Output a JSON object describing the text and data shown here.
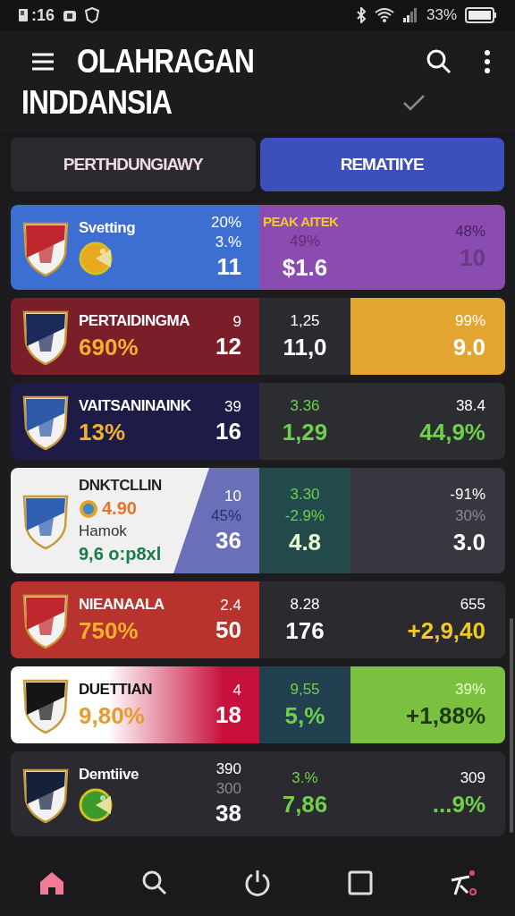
{
  "status_bar": {
    "time": ":16",
    "battery": "33%"
  },
  "header": {
    "title_lines": [
      "OLAHRAGAN",
      "INDDANSIA"
    ]
  },
  "tabs": [
    {
      "label": "PERTHDUNGIAWY",
      "selected": false
    },
    {
      "label": "REMATIIYE",
      "selected": true
    }
  ],
  "cards": [
    {
      "left": {
        "color": "#3d6fd2"
      },
      "name": {
        "text": "Svetting",
        "color": "#ffffff"
      },
      "lines": [
        {
          "kind": "icon",
          "color": "#e8a820"
        }
      ],
      "stats": [
        {
          "text": "20%",
          "kind": "small",
          "color": "#ffffff"
        },
        {
          "text": "3.%",
          "kind": "small",
          "color": "#ffffff"
        },
        {
          "text": "11",
          "kind": "big",
          "color": "#ffffff"
        }
      ],
      "mid": {
        "color": "#8a4cb0",
        "lines": [
          {
            "text": "PEAK AITEK",
            "kind": "label",
            "color": "#f2c82c"
          },
          {
            "text": "49%",
            "kind": "small",
            "color": "#6a2a70"
          },
          {
            "text": "$1.6",
            "kind": "big",
            "color": "#ffffff"
          }
        ]
      },
      "right": {
        "color": "#8a4cb0",
        "lines": [
          {
            "text": "48%",
            "kind": "small",
            "color": "#4a2260"
          },
          {
            "text": "10",
            "kind": "big",
            "color": "#6a3a80"
          }
        ]
      }
    },
    {
      "left": {
        "color": "#7a1f2a"
      },
      "name": {
        "text": "PERTAIDINGMA",
        "color": "#ffffff"
      },
      "lines": [
        {
          "kind": "big",
          "text": "690%",
          "color": "#f2b12c"
        }
      ],
      "stats": [
        {
          "text": "9",
          "kind": "small",
          "color": "#ffffff"
        },
        {
          "text": "12",
          "kind": "big",
          "color": "#ffffff"
        }
      ],
      "mid": {
        "color": "#2b2b2f",
        "lines": [
          {
            "text": "1,25",
            "kind": "small",
            "color": "#ffffff"
          },
          {
            "text": "11,0",
            "kind": "big",
            "color": "#ffffff"
          }
        ]
      },
      "right": {
        "color": "#e3a532",
        "lines": [
          {
            "text": "99%",
            "kind": "small",
            "color": "#ffffff"
          },
          {
            "text": "9.0",
            "kind": "big",
            "color": "#ffffff"
          }
        ]
      }
    },
    {
      "left": {
        "color": "#1e1b46"
      },
      "name": {
        "text": "VAITSANINAINK",
        "color": "#ffffff"
      },
      "lines": [
        {
          "kind": "big",
          "text": "13%",
          "color": "#f2b12c"
        }
      ],
      "stats": [
        {
          "text": "39",
          "kind": "small",
          "color": "#ffffff"
        },
        {
          "text": "16",
          "kind": "big",
          "color": "#ffffff"
        }
      ],
      "mid": {
        "color": "#2c2d30",
        "lines": [
          {
            "text": "3.36",
            "kind": "small",
            "color": "#6fd04a"
          },
          {
            "text": "1,29",
            "kind": "big",
            "color": "#6fd04a"
          }
        ]
      },
      "right": {
        "color": "#2c2d30",
        "lines": [
          {
            "text": "38.4",
            "kind": "small",
            "color": "#ffffff"
          },
          {
            "text": "44,9%",
            "kind": "big",
            "color": "#6fd04a"
          }
        ]
      }
    },
    {
      "left": {
        "color": "#f0f0f0",
        "band": {
          "kind": "split",
          "color": "#6a70b8"
        }
      },
      "name": {
        "text": "DNKTCLLIN",
        "color": "#222222"
      },
      "lines": [
        {
          "kind": "icon-text",
          "text": "4.90",
          "color": "#e8742a"
        },
        {
          "kind": "small",
          "text": "Hamok",
          "color": "#333333"
        },
        {
          "kind": "mid",
          "text": "9,6 o:p8xl",
          "color": "#1a7a4a"
        }
      ],
      "stats": [
        {
          "text": "10",
          "kind": "small",
          "color": "#ffffff"
        },
        {
          "text": "45%",
          "kind": "small",
          "color": "#2a2e70"
        },
        {
          "text": "36",
          "kind": "big",
          "color": "#ffffff"
        }
      ],
      "mid": {
        "color": "#234a4a",
        "lines": [
          {
            "text": "3.30",
            "kind": "small",
            "color": "#6fd04a"
          },
          {
            "text": "-2.9%",
            "kind": "small",
            "color": "#6fd04a"
          },
          {
            "text": "4.8",
            "kind": "big",
            "color": "#e8ffd0"
          }
        ]
      },
      "right": {
        "color": "#38363f",
        "lines": [
          {
            "text": "-91%",
            "kind": "small",
            "color": "#ffffff"
          },
          {
            "text": "30%",
            "kind": "small",
            "color": "#8c8a9c"
          },
          {
            "text": "3.0",
            "kind": "big",
            "color": "#ffffff"
          }
        ]
      }
    },
    {
      "left": {
        "color": "#b8322e"
      },
      "name": {
        "text": "NIEANAALA",
        "color": "#ffffff"
      },
      "lines": [
        {
          "kind": "big",
          "text": "750%",
          "color": "#f2b12c"
        }
      ],
      "stats": [
        {
          "text": "2.4",
          "kind": "small",
          "color": "#ffffff"
        },
        {
          "text": "50",
          "kind": "big",
          "color": "#ffffff"
        }
      ],
      "mid": {
        "color": "#2b2b2f",
        "lines": [
          {
            "text": "8.28",
            "kind": "small",
            "color": "#ffffff"
          },
          {
            "text": "176",
            "kind": "big",
            "color": "#ffffff"
          }
        ]
      },
      "right": {
        "color": "#2b2b2f",
        "lines": [
          {
            "text": "655",
            "kind": "small",
            "color": "#ffffff"
          },
          {
            "text": "+2,9,40",
            "kind": "big",
            "color": "#f0c828"
          }
        ]
      }
    },
    {
      "left": {
        "color": "#ffffff",
        "band": {
          "kind": "fade",
          "color": "#c8103c"
        }
      },
      "name": {
        "text": "DUETTIAN",
        "color": "#111111"
      },
      "lines": [
        {
          "kind": "big",
          "text": "9,80%",
          "color": "#e89a2a"
        }
      ],
      "stats": [
        {
          "text": "4",
          "kind": "small",
          "color": "#ffffff"
        },
        {
          "text": "18",
          "kind": "big",
          "color": "#ffffff"
        }
      ],
      "mid": {
        "color": "#234050",
        "lines": [
          {
            "text": "9,55",
            "kind": "small",
            "color": "#6fd04a"
          },
          {
            "text": "5,%",
            "kind": "big",
            "color": "#6fd04a"
          }
        ]
      },
      "right": {
        "color": "#7cc040",
        "lines": [
          {
            "text": "39%",
            "kind": "small",
            "color": "#e8ffd0"
          },
          {
            "text": "+1,88%",
            "kind": "big",
            "color": "#1e3a14"
          }
        ]
      }
    },
    {
      "left": {
        "color": "#2a2a30"
      },
      "name": {
        "text": "Demtiive",
        "color": "#ffffff"
      },
      "lines": [
        {
          "kind": "icon",
          "color": "#3a9a2a"
        }
      ],
      "stats": [
        {
          "text": "390",
          "kind": "small",
          "color": "#ffffff"
        },
        {
          "text": "300",
          "kind": "small",
          "color": "#8a8a8a"
        },
        {
          "text": "38",
          "kind": "big",
          "color": "#ffffff"
        }
      ],
      "mid": {
        "color": "#2a2a30",
        "lines": [
          {
            "text": "3.%",
            "kind": "small",
            "color": "#6fd04a"
          },
          {
            "text": "7,86",
            "kind": "big",
            "color": "#6fd04a"
          }
        ]
      },
      "right": {
        "color": "#2a2a30",
        "lines": [
          {
            "text": "309",
            "kind": "small",
            "color": "#ffffff"
          },
          {
            "text": "...9%",
            "kind": "big",
            "color": "#6fd04a"
          }
        ]
      }
    }
  ],
  "nav": [
    {
      "kind": "home",
      "selected": true
    },
    {
      "kind": "search",
      "selected": false
    },
    {
      "kind": "power",
      "selected": false
    },
    {
      "kind": "square",
      "selected": false
    },
    {
      "kind": "figure",
      "selected": false
    }
  ]
}
